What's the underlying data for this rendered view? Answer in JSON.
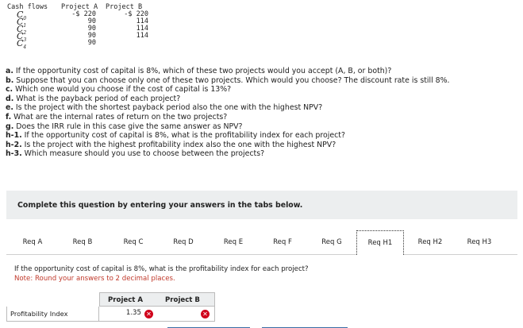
{
  "cash_flows": {
    "header_label": "Cash flows",
    "project_a_label": "Project A",
    "project_b_label": "Project B",
    "rows": [
      {
        "label": "C0",
        "a": "-$ 220",
        "b": "-$ 220"
      },
      {
        "label": "C1",
        "a": "90",
        "b": "114"
      },
      {
        "label": "C2",
        "a": "90",
        "b": "114"
      },
      {
        "label": "C3",
        "a": "90",
        "b": "114"
      },
      {
        "label": "C4",
        "a": "90",
        "b": ""
      }
    ]
  },
  "questions": [
    {
      "prefix": "a.",
      "text": " If the opportunity cost of capital is 8%, which of these two projects would you accept (A, B, or both)?"
    },
    {
      "prefix": "b.",
      "text": " Suppose that you can choose only one of these two projects. Which would you choose? The discount rate is still 8%."
    },
    {
      "prefix": "c.",
      "text": " Which one would you choose if the cost of capital is 13%?"
    },
    {
      "prefix": "d.",
      "text": " What is the payback period of each project?"
    },
    {
      "prefix": "e.",
      "text": " Is the project with the shortest payback period also the one with the highest NPV?"
    },
    {
      "prefix": "f.",
      "text": " What are the internal rates of return on the two projects?"
    },
    {
      "prefix": "g.",
      "text": " Does the IRR rule in this case give the same answer as NPV?"
    },
    {
      "prefix": "h-1.",
      "text": " If the opportunity cost of capital is 8%, what is the profitability index for each project?"
    },
    {
      "prefix": "h-2.",
      "text": " Is the project with the highest profitability index also the one with the highest NPV?"
    },
    {
      "prefix": "h-3.",
      "text": " Which measure should you use to choose between the projects?"
    }
  ],
  "complete_text": "Complete this question by entering your answers in the tabs below.",
  "tabs": [
    "Req A",
    "Req B",
    "Req C",
    "Req D",
    "Req E",
    "Req F",
    "Req G",
    "Req H1",
    "Req H2",
    "Req H3"
  ],
  "active_tab": "Req H1",
  "instruction": "If the opportunity cost of capital is 8%, what is the profitability index for each project?",
  "note": "Note: Round your answers to 2 decimal places.",
  "answer_table": {
    "col_a": "Project A",
    "col_b": "Project B",
    "row_label": "Profitability Index",
    "value_a": "1.35",
    "value_b": ""
  },
  "colors": {
    "error": "#d0021b",
    "note": "#c0392b",
    "accent": "#3a6ea5"
  },
  "icons": {
    "incorrect": "x-circle-icon"
  }
}
